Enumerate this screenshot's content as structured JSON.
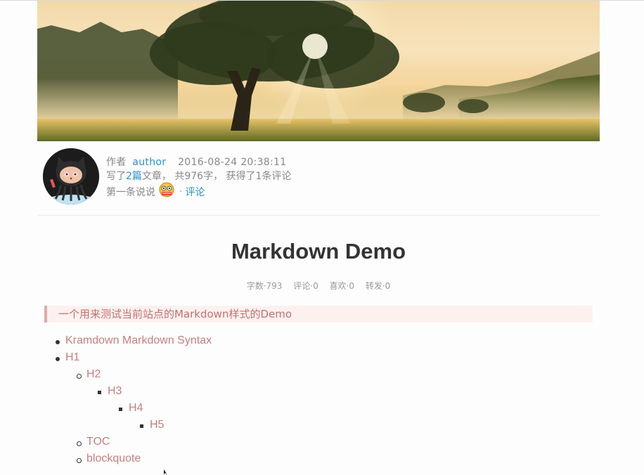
{
  "author_block": {
    "author_prefix": "作者",
    "author_name": "author",
    "date": "2016-08-24 20:38:11",
    "wrote_prefix": "写了",
    "post_count": "2篇",
    "wrote_suffix": "文章， 共976字， 获得了1条评论",
    "first_comment_label": "第一条说说",
    "separator": "·",
    "comment_link": "评论"
  },
  "article": {
    "title": "Markdown Demo",
    "stats": {
      "words": "字数·793",
      "comments": "评论·0",
      "likes": "喜欢·0",
      "reposts": "转发·0"
    },
    "blockquote": "一个用来测试当前站点的Markdown样式的Demo",
    "toc": [
      {
        "label": "Kramdown Markdown Syntax",
        "level": 1
      },
      {
        "label": "H1",
        "level": 1
      },
      {
        "label": "H2",
        "level": 2
      },
      {
        "label": "H3",
        "level": 3
      },
      {
        "label": "H4",
        "level": 4
      },
      {
        "label": "H5",
        "level": 5
      },
      {
        "label": "TOC",
        "level": 2
      },
      {
        "label": "blockquote",
        "level": 2
      }
    ]
  },
  "colors": {
    "link": "#2f8fc8",
    "toc_link": "#c57f7f",
    "quote_border": "#e0a8a8",
    "quote_bg": "#fdf1f0"
  }
}
